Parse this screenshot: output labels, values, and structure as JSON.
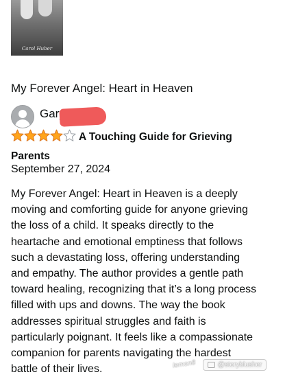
{
  "book": {
    "title": "My Forever Angel: Heart in Heaven",
    "cover_author": "Carol Huber"
  },
  "review": {
    "reviewer_name": "Gary J.",
    "rating": 4,
    "rating_max": 5,
    "star_color": "#ffa41c",
    "headline": "A Touching Guide for Grieving Parents",
    "date": "September 27, 2024",
    "body": "My Forever Angel: Heart in Heaven is a deeply moving and comforting guide for anyone grieving the loss of a child. It speaks directly to the heartache and emotional emptiness that follows such a devastating loss, offering understanding and empathy. The author provides a gentle path toward healing, recognizing that it’s a long process filled with ups and downs. The way the book addresses spiritual struggles and faith is particularly poignant. It feels like a compassionate companion for parents navigating the hardest battle of their lives."
  },
  "overlay": {
    "redaction_color": "#ef5a5a",
    "watermark_logo": "lemon8",
    "watermark_handle": "@storyblusher"
  }
}
